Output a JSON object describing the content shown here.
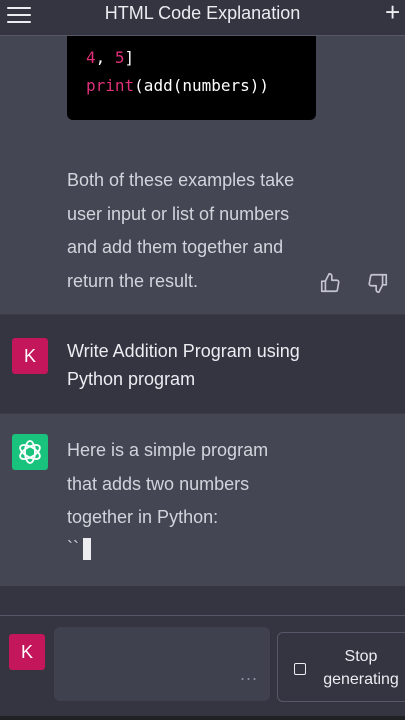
{
  "header": {
    "title": "HTML Code Explanation",
    "menu_icon": "hamburger-menu-icon",
    "new_chat_icon": "plus-icon"
  },
  "code_block": {
    "line1_num": "4",
    "line1_sep": ", ",
    "line1_num2": "5",
    "line1_end": "]",
    "line2_fn": "print",
    "line2_rest": "(add(numbers))"
  },
  "assistant_message_1": {
    "lines": [
      "Both of these examples take",
      "user input or list of numbers",
      "and add them together and",
      "return the result."
    ]
  },
  "feedback": {
    "thumbs_up_icon": "thumbs-up-icon",
    "thumbs_down_icon": "thumbs-down-icon"
  },
  "user_message": {
    "avatar_letter": "K",
    "lines": [
      "Write Addition Program using",
      "Python program"
    ]
  },
  "assistant_message_2": {
    "avatar_icon": "openai-logo-icon",
    "lines": [
      "Here is a simple program",
      "that adds two numbers",
      "together in Python:",
      "``"
    ]
  },
  "composer": {
    "avatar_letter": "K",
    "more_indicator": "...",
    "stop_label": "Stop\ngenerating",
    "stop_icon": "stop-square-icon"
  },
  "colors": {
    "user_avatar": "#c3165b",
    "assistant_avatar": "#19c37d",
    "code_accent": "#df3079"
  }
}
